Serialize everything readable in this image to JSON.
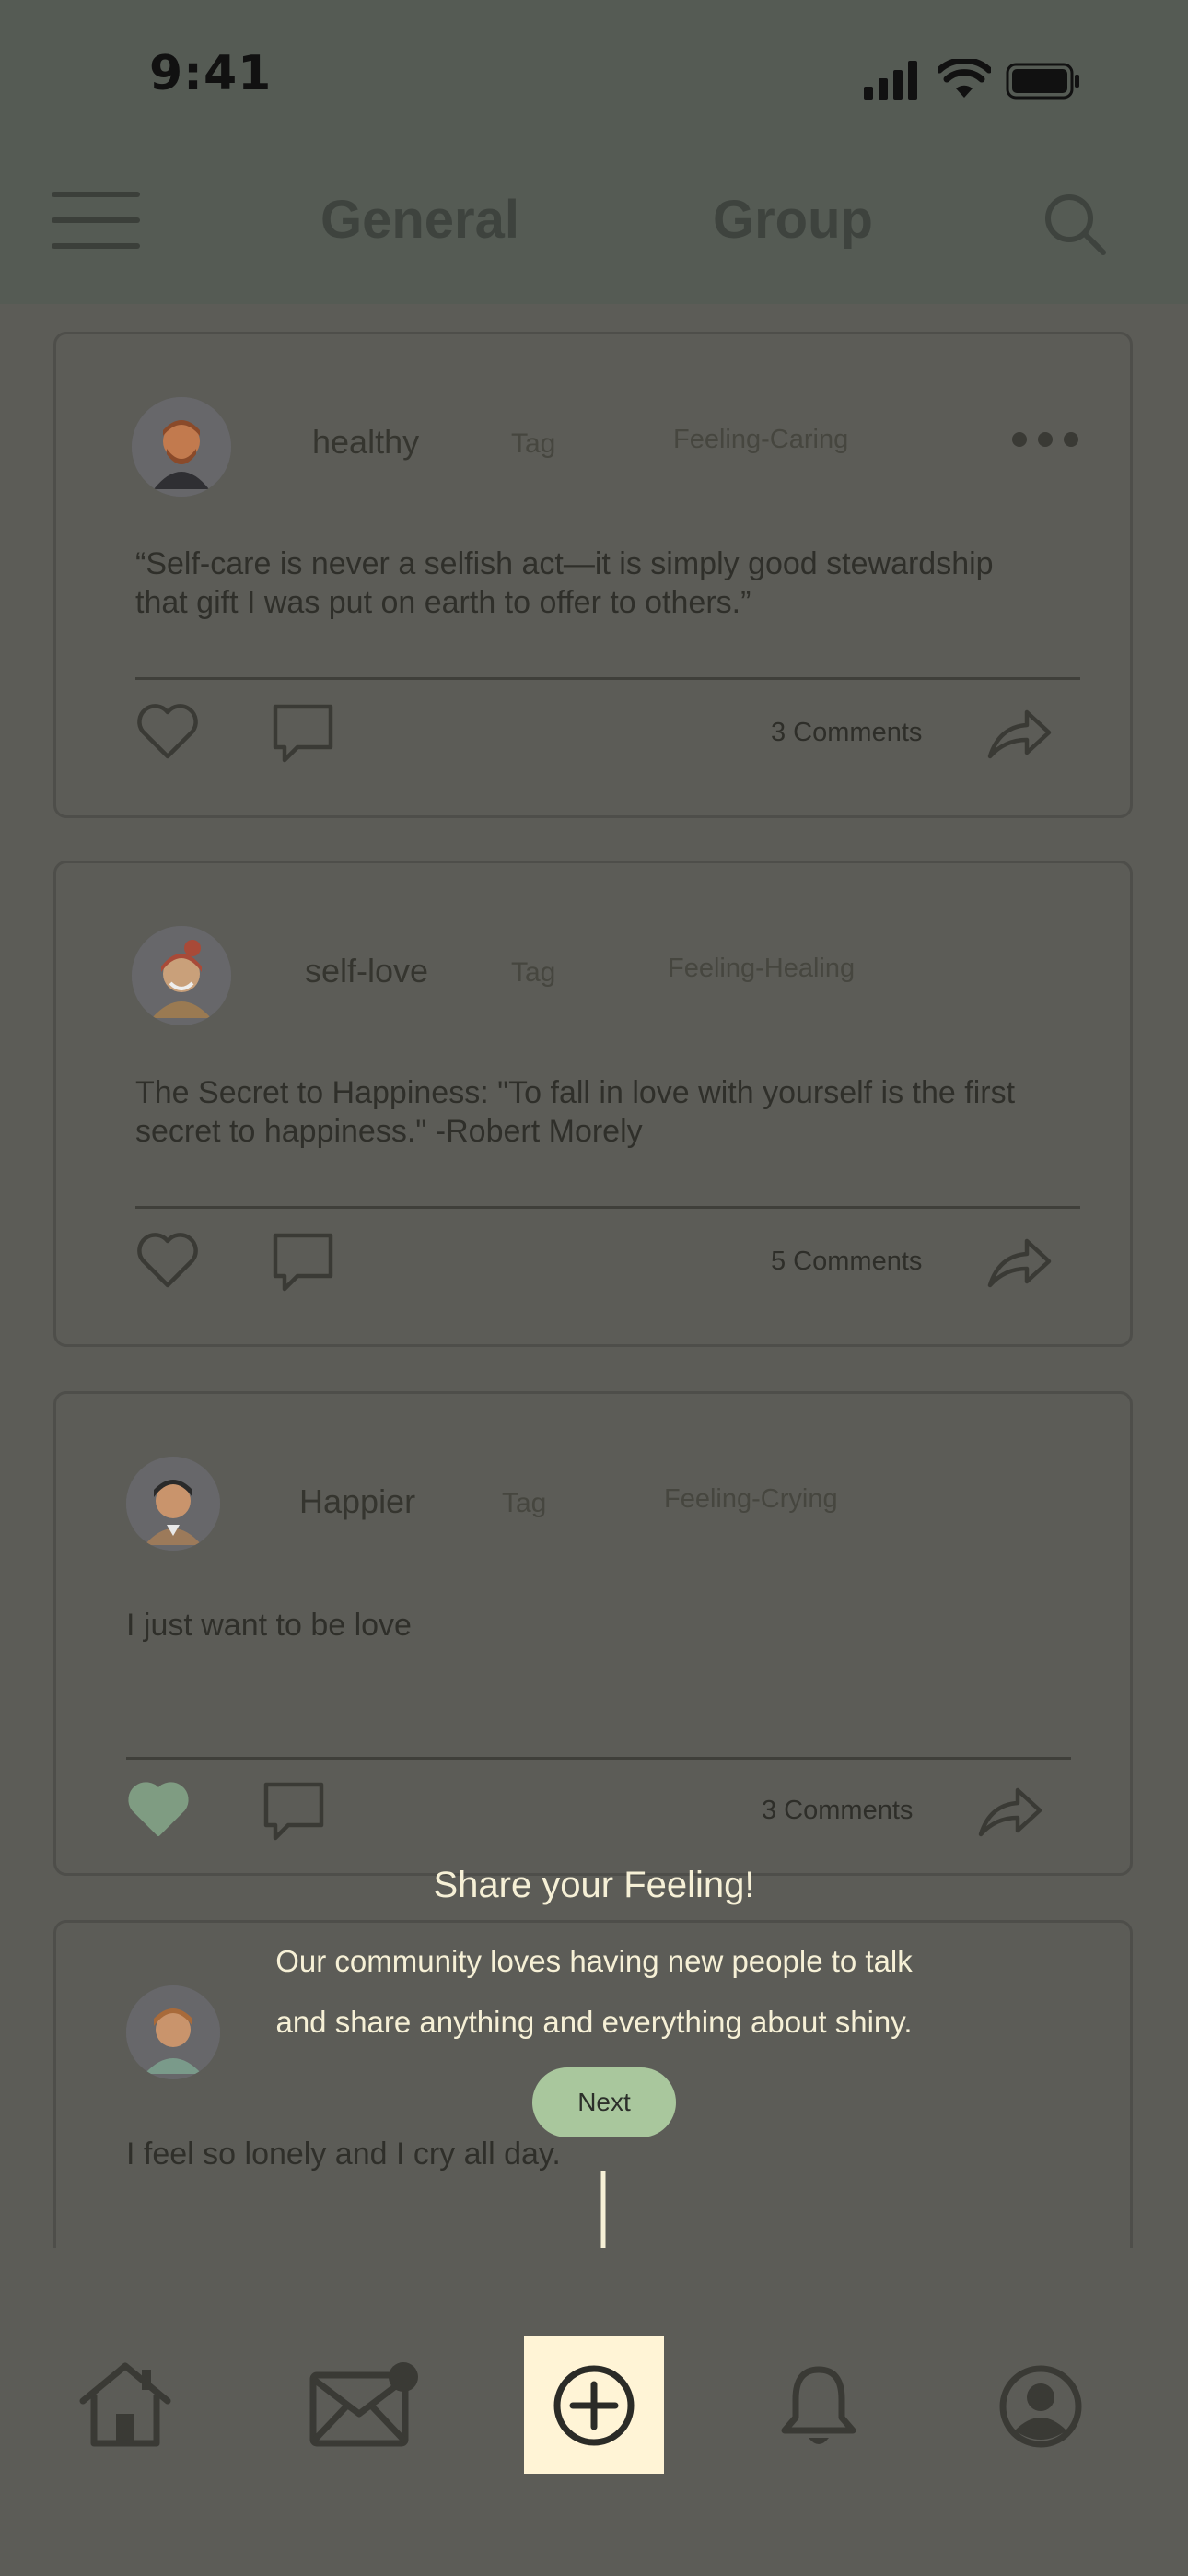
{
  "status_bar": {
    "time": "9:41"
  },
  "header": {
    "tabs": [
      {
        "label": "General"
      },
      {
        "label": "Group"
      }
    ]
  },
  "posts": [
    {
      "username": "healthy",
      "tag": "Tag",
      "feeling": "Feeling-Caring",
      "text_line1": "“Self-care is never a selfish act—it is simply good stewardship",
      "text_line2": "that gift I was put on earth to offer to others.”",
      "comments": "3 Comments",
      "liked": false
    },
    {
      "username": "self-love",
      "tag": "Tag",
      "feeling": "Feeling-Healing",
      "text_line1": "The Secret to Happiness: \"To fall in love with yourself is the first",
      "text_line2": "secret to happiness.\" -Robert Morely",
      "comments": "5 Comments",
      "liked": false
    },
    {
      "username": "Happier",
      "tag": "Tag",
      "feeling": "Feeling-Crying",
      "text_line1": "I just want to be love",
      "text_line2": "",
      "comments": "3 Comments",
      "liked": true
    },
    {
      "username": "",
      "tag": "",
      "feeling": "",
      "text_line1": "I feel so lonely and I cry all day.",
      "text_line2": "",
      "comments": "",
      "liked": false
    }
  ],
  "onboarding": {
    "title": "Share your Feeling!",
    "line1": "Our community loves having new people to talk",
    "line2": "and share anything and everything about shiny.",
    "next_label": "Next"
  },
  "bottom_nav": {
    "items": [
      "home-icon",
      "mail-icon",
      "add-post-icon",
      "bell-icon",
      "profile-icon"
    ],
    "mail_has_badge": true
  },
  "colors": {
    "liked_heart": "#7f9c82",
    "highlight": "#fff4d6",
    "next_button": "#a9c79d",
    "overlay_text": "#f6f0d6"
  }
}
